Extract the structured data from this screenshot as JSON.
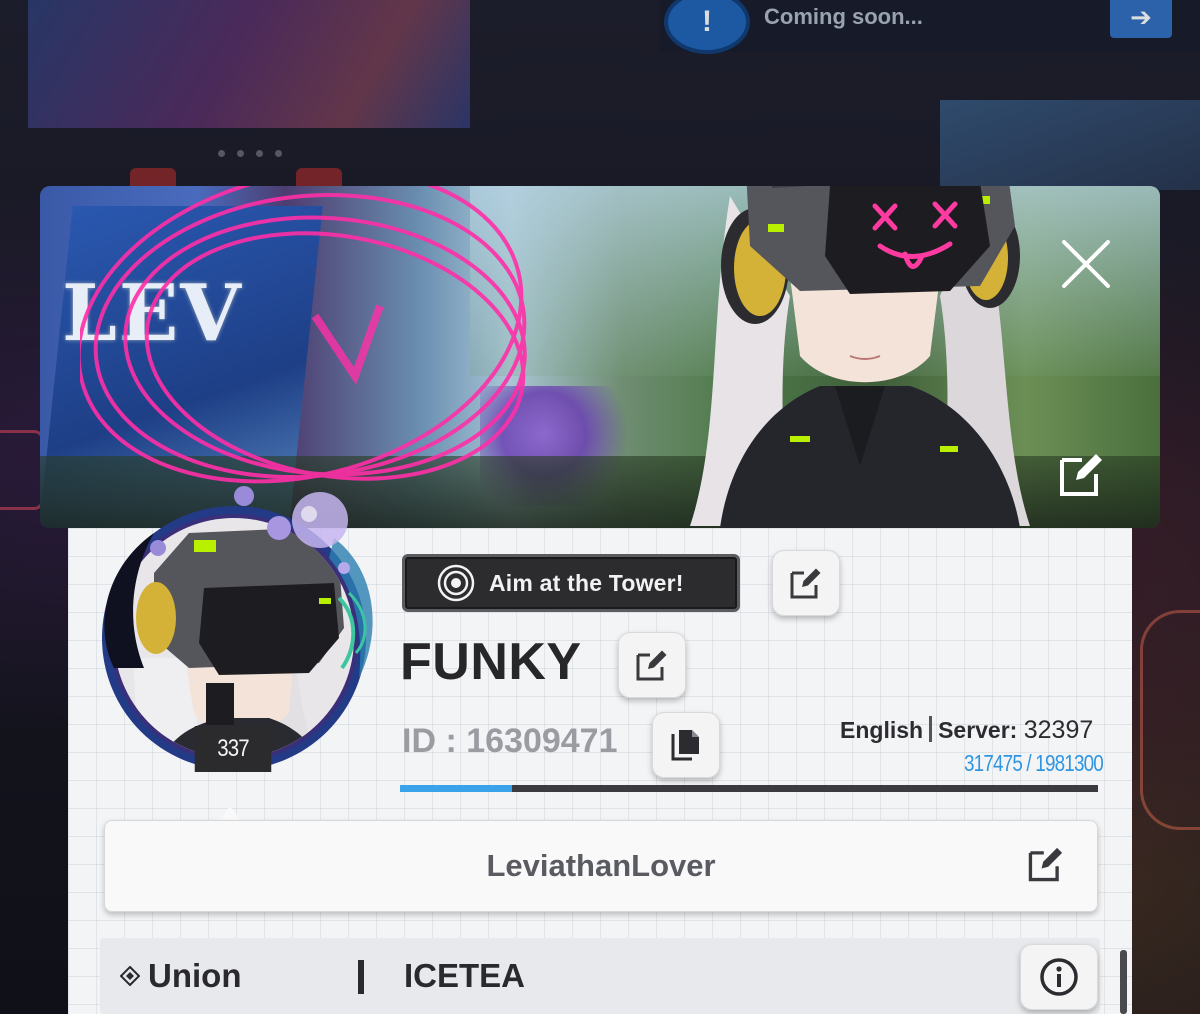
{
  "background": {
    "notice_text": "Coming soon...",
    "event_banner_title": "",
    "event_banner_subtitle": ""
  },
  "profile": {
    "title": "Aim at the Tower!",
    "name": "FUNKY",
    "id_text": "ID : 16309471",
    "level": "337",
    "language": "English",
    "server_label": "Server:",
    "server_number": "32397",
    "exp_text": "317475 / 1981300",
    "exp_current": 317475,
    "exp_max": 1981300,
    "guild_name": "LeviathanLover",
    "union_label": "Union",
    "union_name": "ICETEA"
  },
  "icons": {
    "close": "close-icon",
    "edit": "edit-icon",
    "copy": "copy-icon",
    "info": "info-icon",
    "title_badge": "target-icon",
    "union": "union-icon"
  },
  "colors": {
    "accent": "#3aa2e8",
    "scribble": "#ff2fa8",
    "panel": "#f3f4f6",
    "dark_chip": "#2c2c2f",
    "visor_accent": "#ff3aa0",
    "lime_accent": "#b8f000"
  }
}
